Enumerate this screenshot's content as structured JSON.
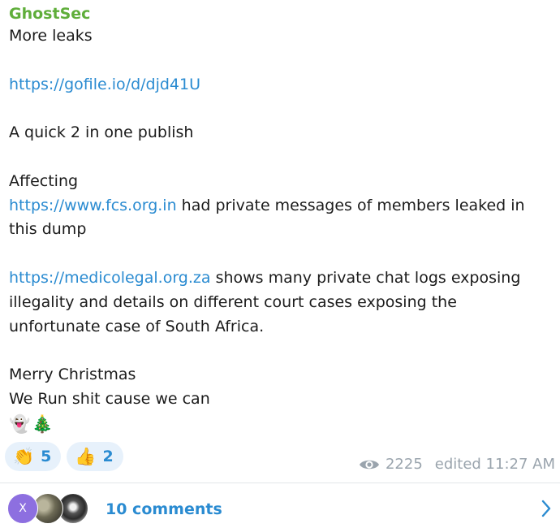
{
  "post": {
    "sender": "GhostSec",
    "lines": {
      "l1": "More leaks",
      "link1": "https://gofile.io/d/djd41U",
      "l3": "A quick 2 in one publish",
      "l4": "Affecting",
      "link2": "https://www.fcs.org.in",
      "l5_rest": " had private messages of members leaked in",
      "l6": "this dump",
      "link3": "https://medicolegal.org.za",
      "l7_rest": " shows many private chat logs exposing",
      "l8": "illegality and details on different court cases exposing the",
      "l9": "unfortunate case of South Africa.",
      "l10": "Merry Christmas",
      "l11": "We Run shit cause we can",
      "emojis": "👻🎄"
    }
  },
  "reactions": [
    {
      "emoji": "👏",
      "count": "5"
    },
    {
      "emoji": "👍",
      "count": "2"
    }
  ],
  "meta": {
    "views": "2225",
    "edited": "edited 11:27 AM",
    "icon": "eye-icon"
  },
  "comments": {
    "label": "10 comments",
    "avatar_initial": "X",
    "chevron_icon": "chevron-right-icon"
  },
  "colors": {
    "sender": "#5fae3a",
    "link": "#2a8bd1",
    "meta": "#9aa4ad",
    "reaction_bg": "#e7f1fb"
  }
}
